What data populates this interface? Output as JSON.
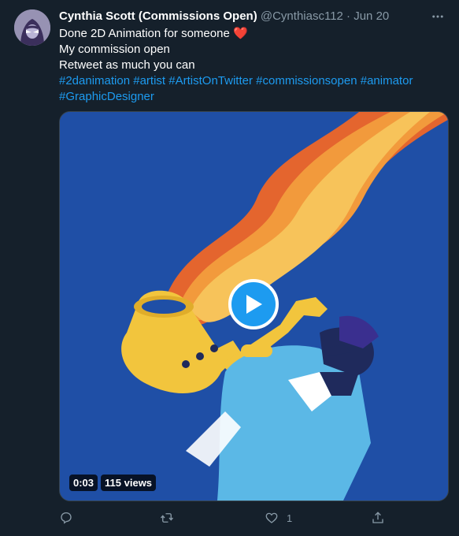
{
  "tweet": {
    "author_name": "Cynthia Scott (Commissions Open)",
    "handle": "@Cynthiasc112",
    "separator": "·",
    "date": "Jun 20",
    "more_icon": "more-dots-icon",
    "text_line1": "Done 2D Animation for someone",
    "heart_emoji": "❤️",
    "text_line2": "My commission open",
    "text_line3": "Retweet as much you can",
    "hashtags": [
      "#2danimation",
      "#artist",
      "#ArtistOnTwitter",
      "#commissionsopen",
      "#animator",
      "#GraphicDesigner"
    ]
  },
  "video": {
    "duration": "0:03",
    "views": "115 views",
    "play_icon": "play-icon"
  },
  "actions": {
    "reply_icon": "reply-icon",
    "retweet_icon": "retweet-icon",
    "like_icon": "heart-icon",
    "like_count": "1",
    "share_icon": "share-icon"
  },
  "colors": {
    "background": "#15202b",
    "link": "#1d9bf0",
    "muted": "#8899a6",
    "video_bg": "#1f4fa6"
  }
}
